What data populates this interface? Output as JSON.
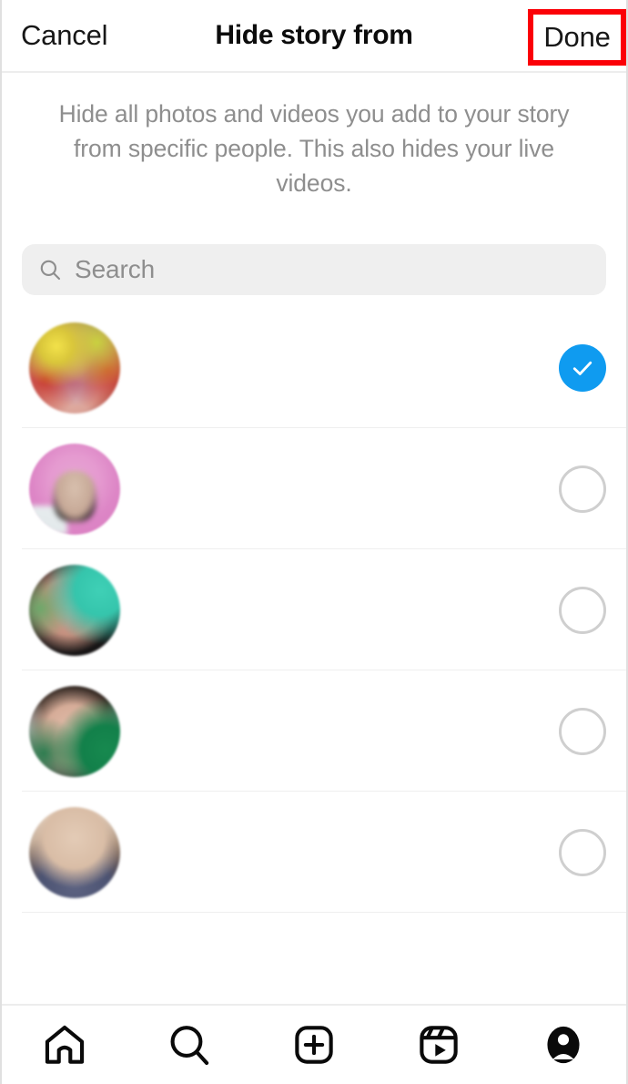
{
  "header": {
    "cancel_label": "Cancel",
    "title": "Hide story from",
    "done_label": "Done",
    "annotation_color": "#fb0007"
  },
  "description": "Hide all photos and videos you add to your story from specific people. This also hides your live videos.",
  "search": {
    "placeholder": "Search",
    "value": "",
    "icon": "search-icon"
  },
  "colors": {
    "selected_blue": "#0f9bf0",
    "unselected_border": "#cfcfcf",
    "divider": "#efefef",
    "muted_text": "#8e8e8e",
    "search_background": "#efefef"
  },
  "people": [
    {
      "username": "",
      "fullname": "",
      "selected": true,
      "avatar": "avatar-colorful-portrait"
    },
    {
      "username": "",
      "fullname": "",
      "selected": false,
      "avatar": "avatar-pink-portrait"
    },
    {
      "username": "",
      "fullname": "",
      "selected": false,
      "avatar": "avatar-dark-teal-portrait"
    },
    {
      "username": "",
      "fullname": "",
      "selected": false,
      "avatar": "avatar-green-portrait"
    },
    {
      "username": "",
      "fullname": "",
      "selected": false,
      "avatar": "avatar-brown-hair-portrait"
    }
  ],
  "tabbar": [
    {
      "name": "home-icon",
      "label": "Home"
    },
    {
      "name": "search-icon",
      "label": "Search"
    },
    {
      "name": "create-icon",
      "label": "Create"
    },
    {
      "name": "reels-icon",
      "label": "Reels"
    },
    {
      "name": "profile-icon",
      "label": "Profile"
    }
  ]
}
